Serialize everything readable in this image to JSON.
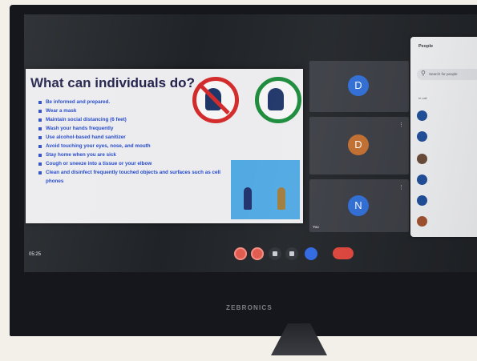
{
  "slide": {
    "title": "What can individuals do?",
    "items": [
      "Be informed and prepared.",
      "Wear a mask",
      "Maintain social distancing (6 feet)",
      "Wash your hands frequently",
      "Use alcohol-based hand sanitizer",
      "Avoid touching your eyes, nose, and mouth",
      "Stay home when you are sick",
      "Cough or sneeze into a tissue or your elbow",
      "Clean and disinfect frequently touched objects and surfaces such as cell phones"
    ]
  },
  "tiles": [
    {
      "initial": "D",
      "name": "",
      "color": "#2f6ed8"
    },
    {
      "initial": "D",
      "name": "",
      "color": "#c46f2e"
    },
    {
      "initial": "N",
      "name": "You",
      "color": "#2f6ed8"
    }
  ],
  "people": {
    "title": "People",
    "search_placeholder": "Search for people",
    "in_call_label": "In call",
    "rows": [
      {
        "name": "",
        "color": "#1f4f9c"
      },
      {
        "name": "",
        "color": "#1f4f9c"
      },
      {
        "name": "",
        "color": "#6b4b3a"
      },
      {
        "name": "",
        "color": "#1f4f9c"
      },
      {
        "name": "",
        "color": "#1f4f9c"
      },
      {
        "name": "",
        "color": "#a4522e"
      }
    ]
  },
  "controls": {
    "time": "05:25",
    "meeting_code": "",
    "end_call_label": ""
  },
  "monitor": {
    "brand": "ZEBRONICS"
  }
}
